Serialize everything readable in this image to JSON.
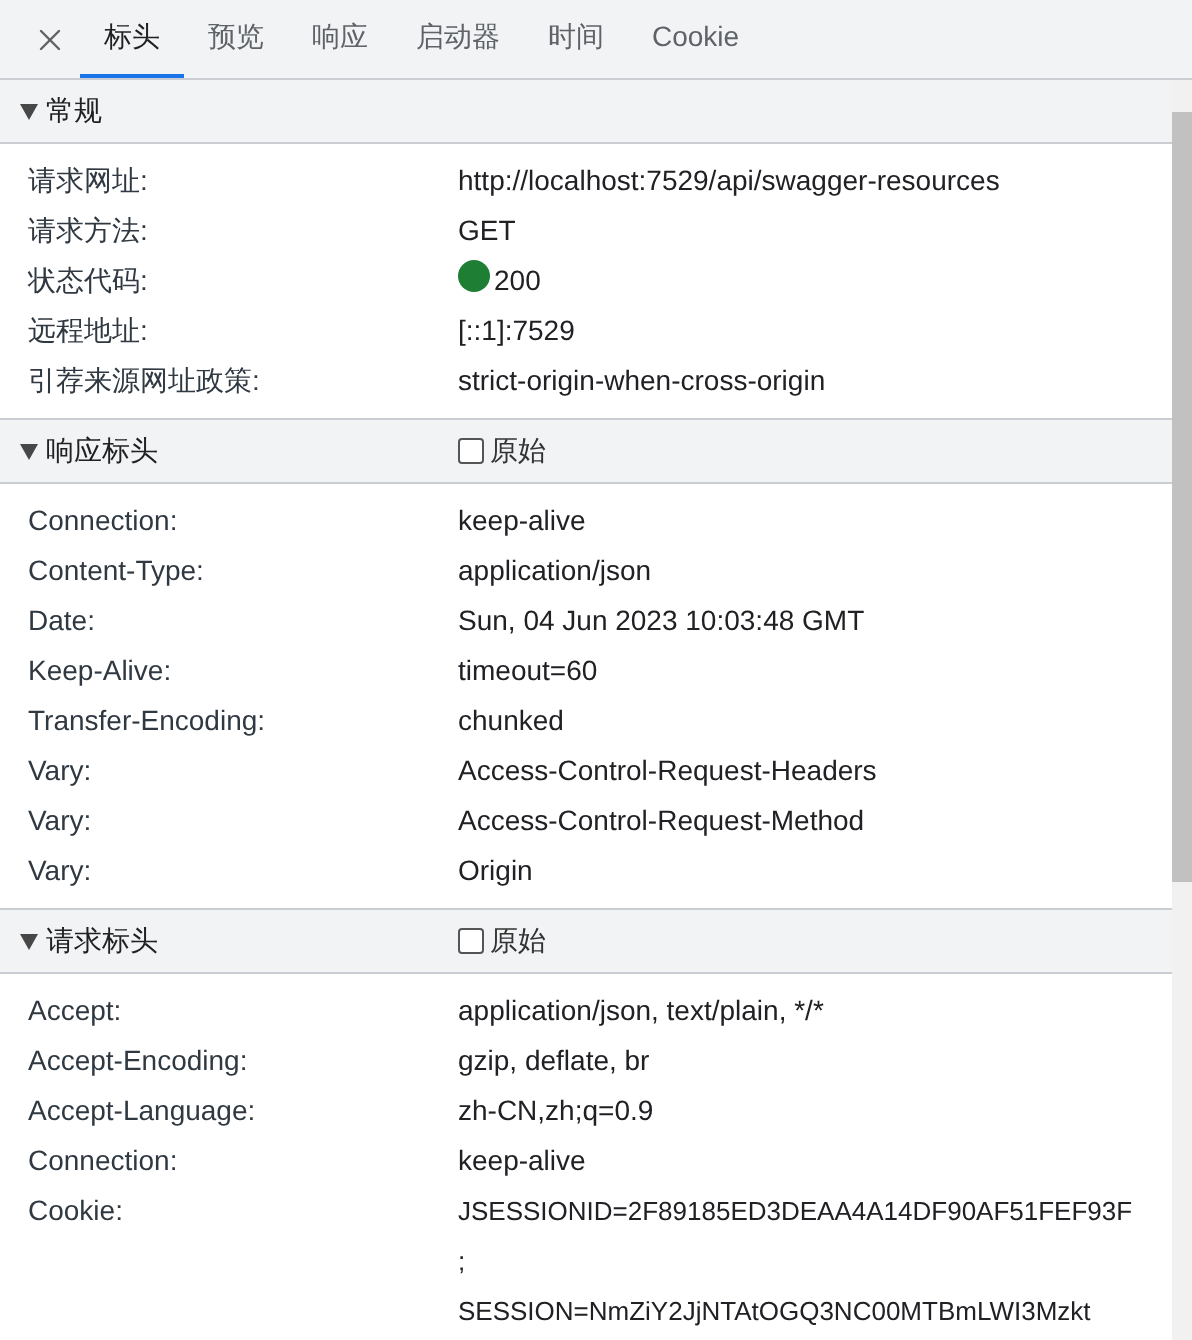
{
  "tabs": [
    {
      "label": "标头",
      "selected": true
    },
    {
      "label": "预览",
      "selected": false
    },
    {
      "label": "响应",
      "selected": false
    },
    {
      "label": "启动器",
      "selected": false
    },
    {
      "label": "时间",
      "selected": false
    },
    {
      "label": "Cookie",
      "selected": false
    }
  ],
  "sections": [
    {
      "title": "常规",
      "expanded": true,
      "rows": [
        {
          "name": "请求网址:",
          "value": "http://localhost:7529/api/swagger-resources"
        },
        {
          "name": "请求方法:",
          "value": "GET"
        },
        {
          "name": "状态代码:",
          "value": "200",
          "color": "#1e7e34"
        },
        {
          "name": "远程地址:",
          "value": "[::1]:7529"
        },
        {
          "name": "引荐来源网址政策:",
          "value": "strict-origin-when-cross-origin"
        }
      ]
    },
    {
      "title": "响应标头",
      "expanded": true,
      "raw": {
        "label": "原始",
        "checked": false
      },
      "rows": [
        {
          "name": "Connection:",
          "value": "keep-alive"
        },
        {
          "name": "Content-Type:",
          "value": "application/json"
        },
        {
          "name": "Date:",
          "value": "Sun, 04 Jun 2023 10:03:48 GMT"
        },
        {
          "name": "Keep-Alive:",
          "value": "timeout=60"
        },
        {
          "name": "Transfer-Encoding:",
          "value": "chunked"
        },
        {
          "name": "Vary:",
          "value": "Access-Control-Request-Headers"
        },
        {
          "name": "Vary:",
          "value": "Access-Control-Request-Method"
        },
        {
          "name": "Vary:",
          "value": "Origin"
        }
      ]
    },
    {
      "title": "请求标头",
      "expanded": true,
      "raw": {
        "label": "原始",
        "checked": false
      },
      "rows": [
        {
          "name": "Accept:",
          "value": "application/json, text/plain, */*"
        },
        {
          "name": "Accept-Encoding:",
          "value": "gzip, deflate, br"
        },
        {
          "name": "Accept-Language:",
          "value": "zh-CN,zh;q=0.9"
        },
        {
          "name": "Connection:",
          "value": "keep-alive"
        },
        {
          "name": "Cookie:",
          "lines": [
            "JSESSIONID=2F89185ED3DEAA4A14DF90AF51FEF93F",
            ";",
            "SESSION=NmZiY2JjNTAtOGQ3NC00MTBmLWI3Mzkt"
          ]
        }
      ]
    }
  ]
}
